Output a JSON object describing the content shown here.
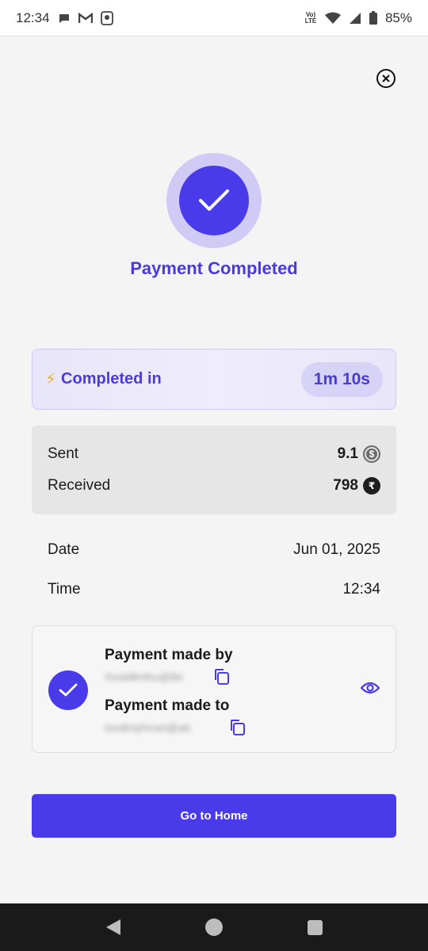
{
  "status_bar": {
    "time": "12:34",
    "battery": "85%",
    "network_label_top": "Vo)",
    "network_label_bottom": "LTE",
    "icons": [
      "chat-icon",
      "gmail-icon",
      "app-icon",
      "wifi-icon",
      "signal-icon",
      "battery-icon"
    ]
  },
  "screen": {
    "title": "Payment Completed",
    "close_icon": "close-icon"
  },
  "completed": {
    "label": "Completed in",
    "duration": "1m 10s",
    "icon": "lightning-icon"
  },
  "amounts": {
    "sent_label": "Sent",
    "sent_value": "9.1",
    "sent_currency_icon": "usd-coin-icon",
    "received_label": "Received",
    "received_value": "798",
    "received_currency_icon": "rupee-icon"
  },
  "details": {
    "date_label": "Date",
    "date_value": "Jun 01, 2025",
    "time_label": "Time",
    "time_value": "12:34"
  },
  "party": {
    "made_by_label": "Payment made by",
    "made_by_value": "rhoddlinthu@tbi",
    "made_to_label": "Payment made to",
    "made_to_value": "lovdiniyhroet@ab",
    "icons": [
      "check-icon",
      "copy-icon",
      "eye-icon"
    ]
  },
  "actions": {
    "home_label": "Go to Home"
  },
  "colors": {
    "accent": "#4a3bea",
    "accent_light": "#cfcbf4",
    "title": "#4a3bd8",
    "bolt": "#f0b323"
  }
}
